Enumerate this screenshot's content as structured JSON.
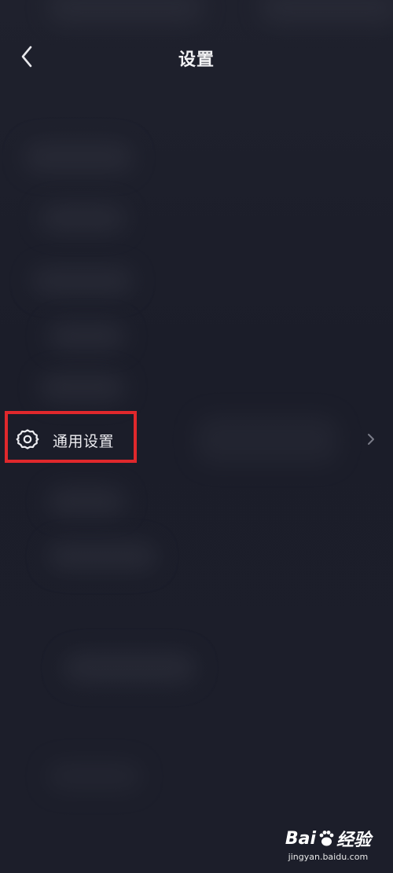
{
  "header": {
    "title": "设置",
    "back_icon": "chevron-left-icon"
  },
  "settings": {
    "general_row": {
      "label": "通用设置",
      "icon": "gear-icon",
      "trailing_icon": "chevron-right-icon"
    }
  },
  "watermark": {
    "logo_text_1": "Bai",
    "logo_text_2": "经验",
    "url": "jingyan.baidu.com"
  },
  "colors": {
    "background": "#1c1e2a",
    "text": "#ececf0",
    "highlight": "#e0282c"
  }
}
